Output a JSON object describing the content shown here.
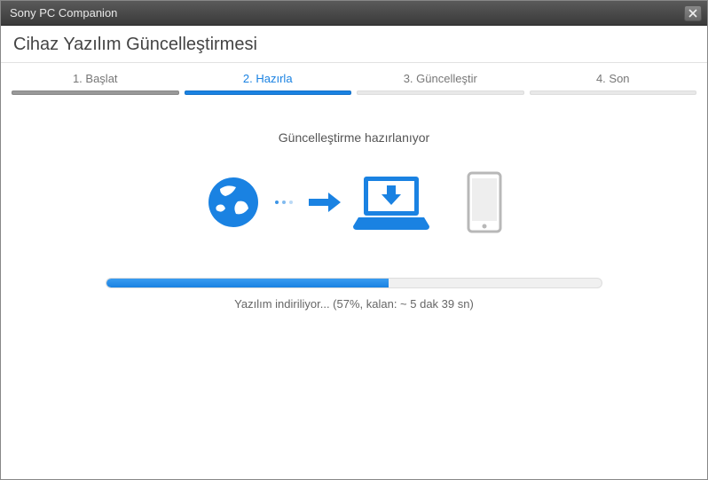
{
  "app_title": "Sony PC Companion",
  "page_title": "Cihaz Yazılım Güncelleştirmesi",
  "steps": [
    {
      "label": "1. Başlat",
      "state": "completed"
    },
    {
      "label": "2. Hazırla",
      "state": "active"
    },
    {
      "label": "3. Güncelleştir",
      "state": "pending"
    },
    {
      "label": "4. Son",
      "state": "pending"
    }
  ],
  "status_heading": "Güncelleştirme hazırlanıyor",
  "progress": {
    "percent": 57,
    "text": "Yazılım indiriliyor... (57%, kalan: ~ 5 dak 39 sn)"
  },
  "colors": {
    "accent": "#1a82e2",
    "inactive": "#b8b8b8"
  }
}
